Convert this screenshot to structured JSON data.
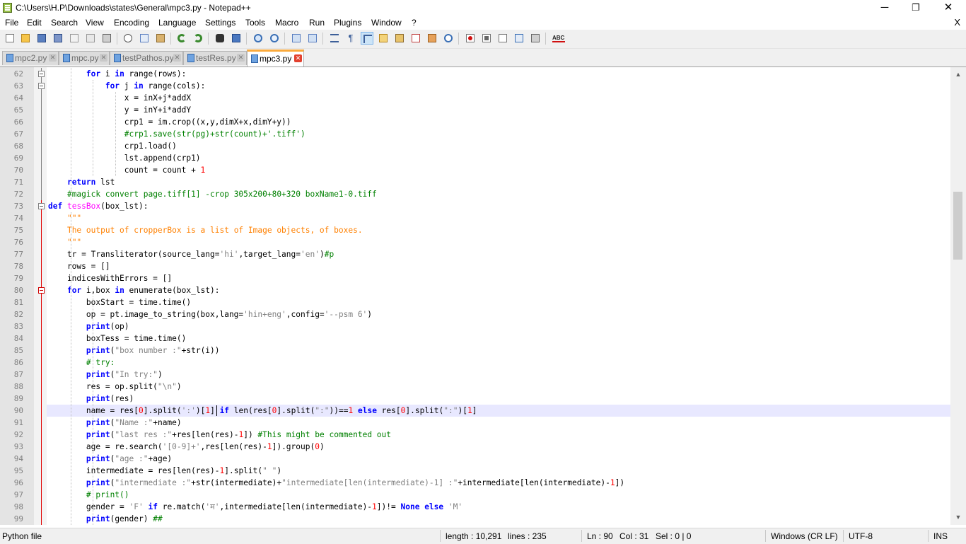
{
  "window": {
    "title": "C:\\Users\\H.P\\Downloads\\states\\General\\mpc3.py - Notepad++",
    "minimize_glyph": "─",
    "restore_glyph": "❐",
    "close_glyph": "✕"
  },
  "menu": {
    "items": [
      "File",
      "Edit",
      "Search",
      "View",
      "Encoding",
      "Language",
      "Settings",
      "Tools",
      "Macro",
      "Run",
      "Plugins",
      "Window",
      "?"
    ],
    "close_label": "X"
  },
  "toolbar": {
    "icons": [
      "new-file-icon",
      "open-file-icon",
      "save-icon",
      "save-all-icon",
      "close-icon",
      "close-all-icon",
      "print-icon",
      "cut-icon",
      "copy-icon",
      "paste-icon",
      "undo-icon",
      "redo-icon",
      "find-icon",
      "replace-icon",
      "zoom-in-icon",
      "zoom-out-icon",
      "sync-vertical-icon",
      "sync-horizontal-icon",
      "word-wrap-icon",
      "show-all-chars-icon",
      "indent-guide-icon",
      "udl-icon",
      "doc-map-icon",
      "function-list-icon",
      "folder-workspace-icon",
      "monitoring-icon",
      "record-macro-icon",
      "stop-record-icon",
      "play-macro-icon",
      "run-macro-multiple-icon",
      "save-macro-icon",
      "spell-check-icon"
    ]
  },
  "tabs": [
    {
      "label": "mpc2.py",
      "active": false
    },
    {
      "label": "mpc.py",
      "active": false
    },
    {
      "label": "testPathos.py",
      "active": false
    },
    {
      "label": "testRes.py",
      "active": false
    },
    {
      "label": "mpc3.py",
      "active": true
    }
  ],
  "tab_close_glyph": "✕",
  "editor": {
    "current_line": 90,
    "lines": [
      {
        "n": "62",
        "html": "        <span class=\"kw\">for</span> i <span class=\"kw\">in</span> range(rows):"
      },
      {
        "n": "63",
        "html": "            <span class=\"kw\">for</span> j <span class=\"kw\">in</span> range(cols):"
      },
      {
        "n": "64",
        "html": "                x = inX+j*addX"
      },
      {
        "n": "65",
        "html": "                y = inY+i*addY"
      },
      {
        "n": "66",
        "html": "                crp1 = im.crop((x,y,dimX+x,dimY+y))"
      },
      {
        "n": "67",
        "html": "                <span class=\"cm\">#crp1.save(str(pg)+str(count)+'.tiff')</span>"
      },
      {
        "n": "68",
        "html": "                crp1.load()"
      },
      {
        "n": "69",
        "html": "                lst.append(crp1)"
      },
      {
        "n": "70",
        "html": "                count = count + <span class=\"num\">1</span>"
      },
      {
        "n": "71",
        "html": "    <span class=\"kw\">return</span> lst"
      },
      {
        "n": "72",
        "html": "    <span class=\"cm\">#magick convert page.tiff[1] -crop 305x200+80+320 boxName1-0.tiff</span>"
      },
      {
        "n": "73",
        "html": "<span class=\"kw\">def</span> <span class=\"fn\">tessBox</span>(box_lst):"
      },
      {
        "n": "74",
        "html": "    <span class=\"ds\">\"\"\"</span>"
      },
      {
        "n": "75",
        "html": "    <span class=\"ds\">The output of cropperBox is a list of Image objects, of boxes.</span>"
      },
      {
        "n": "76",
        "html": "    <span class=\"ds\">\"\"\"</span>"
      },
      {
        "n": "77",
        "html": "    tr = Transliterator(source_lang=<span class=\"str\">'hi'</span>,target_lang=<span class=\"str\">'en'</span>)<span class=\"cm\">#p</span>"
      },
      {
        "n": "78",
        "html": "    rows = []"
      },
      {
        "n": "79",
        "html": "    indicesWithErrors = []"
      },
      {
        "n": "80",
        "html": "    <span class=\"kw\">for</span> i,box <span class=\"kw\">in</span> enumerate(box_lst):"
      },
      {
        "n": "81",
        "html": "        boxStart = time.time()"
      },
      {
        "n": "82",
        "html": "        op = pt.image_to_string(box,lang=<span class=\"str\">'hin+eng'</span>,config=<span class=\"str\">'--psm 6'</span>)"
      },
      {
        "n": "83",
        "html": "        <span class=\"kw\">print</span>(op)"
      },
      {
        "n": "84",
        "html": "        boxTess = time.time()"
      },
      {
        "n": "85",
        "html": "        <span class=\"kw\">print</span>(<span class=\"str\">\"box number :\"</span>+str(i))"
      },
      {
        "n": "86",
        "html": "        <span class=\"cm\"># try:</span>"
      },
      {
        "n": "87",
        "html": "        <span class=\"kw\">print</span>(<span class=\"str\">\"In try:\"</span>)"
      },
      {
        "n": "88",
        "html": "        res = op.split(<span class=\"str\">\"\\n\"</span>)"
      },
      {
        "n": "89",
        "html": "        <span class=\"kw\">print</span>(res)"
      },
      {
        "n": "90",
        "html": "        name = res[<span class=\"num\">0</span>].split(<span class=\"str\">':'</span>)[<span class=\"num\">1</span>] <span class=\"kw\">if</span> len(res[<span class=\"num\">0</span>].split(<span class=\"str\">\":\"</span>))==<span class=\"num\">1</span> <span class=\"kw\">else</span> res[<span class=\"num\">0</span>].split(<span class=\"str\">\":\"</span>)[<span class=\"num\">1</span>]"
      },
      {
        "n": "91",
        "html": "        <span class=\"kw\">print</span>(<span class=\"str\">\"Name :\"</span>+name)"
      },
      {
        "n": "92",
        "html": "        <span class=\"kw\">print</span>(<span class=\"str\">\"last res :\"</span>+res[len(res)-<span class=\"num\">1</span>]) <span class=\"cm\">#This might be commented out</span>"
      },
      {
        "n": "93",
        "html": "        age = re.search(<span class=\"str\">'[0-9]+'</span>,res[len(res)-<span class=\"num\">1</span>]).group(<span class=\"num\">0</span>)"
      },
      {
        "n": "94",
        "html": "        <span class=\"kw\">print</span>(<span class=\"str\">\"age :\"</span>+age)"
      },
      {
        "n": "95",
        "html": "        intermediate = res[len(res)-<span class=\"num\">1</span>].split(<span class=\"str\">\" \"</span>)"
      },
      {
        "n": "96",
        "html": "        <span class=\"kw\">print</span>(<span class=\"str\">\"intermediate :\"</span>+str(intermediate)+<span class=\"str\">\"intermediate[len(intermediate)-1] :\"</span>+intermediate[len(intermediate)-<span class=\"num\">1</span>])"
      },
      {
        "n": "97",
        "html": "        <span class=\"cm\"># print()</span>"
      },
      {
        "n": "98",
        "html": "        gender = <span class=\"str\">'F'</span> <span class=\"kw\">if</span> re.match(<span class=\"str\">'म'</span>,intermediate[len(intermediate)-<span class=\"num\">1</span>])!= <span class=\"kw\">None</span> <span class=\"kw\">else</span> <span class=\"str\">'M'</span>"
      },
      {
        "n": "99",
        "html": "        <span class=\"kw\">print</span>(gender) <span class=\"cm\">##</span>"
      }
    ]
  },
  "scrollbar": {
    "up_glyph": "▲",
    "down_glyph": "▼"
  },
  "status": {
    "file_type": "Python file",
    "length": "length : 10,291",
    "lines": "lines : 235",
    "ln": "Ln : 90",
    "col": "Col : 31",
    "sel": "Sel : 0 | 0",
    "eol": "Windows (CR LF)",
    "encoding": "UTF-8",
    "mode": "INS"
  },
  "colors": {
    "keyword": "#0000ff",
    "number": "#ff0000",
    "string": "#808080",
    "comment": "#008000",
    "docstring": "#ff8000",
    "function_name": "#ff00ff",
    "current_line": "#e8e8ff",
    "active_tab_accent": "#fbaa3c"
  }
}
